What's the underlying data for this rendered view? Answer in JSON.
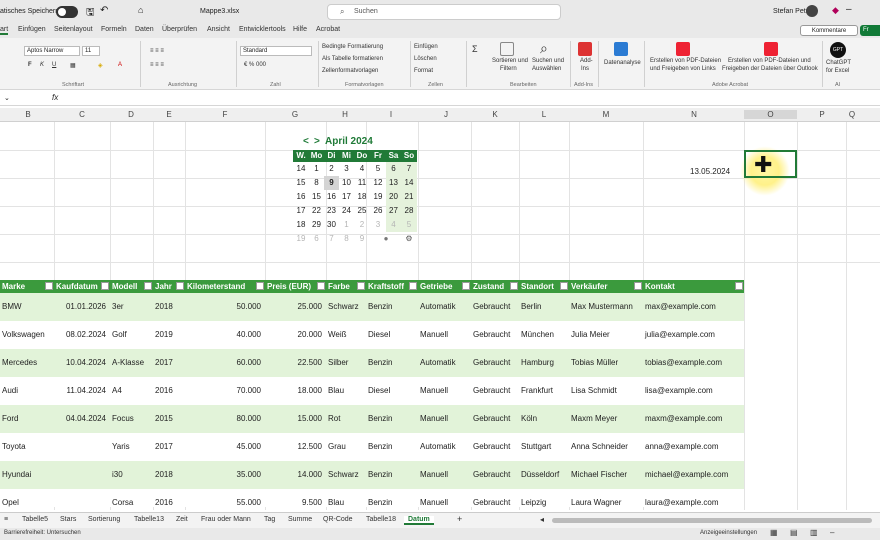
{
  "titlebar": {
    "autosave": "atisches Speichern",
    "file": "Mappe3.xlsx",
    "search": "Suchen",
    "user": "Stefan Petri"
  },
  "tabs": [
    "art",
    "Einfügen",
    "Seitenlayout",
    "Formeln",
    "Daten",
    "Überprüfen",
    "Ansicht",
    "Entwicklertools",
    "Hilfe",
    "Acrobat"
  ],
  "tabs_right": {
    "comments": "Kommentare",
    "share": "Fr"
  },
  "ribbon": {
    "font": "Aptos Narrow",
    "font_size": "11",
    "number_format": "Standard",
    "groups": [
      "Schriftart",
      "Ausrichtung",
      "Zahl",
      "Formatvorlagen",
      "Zellen",
      "Bearbeiten",
      "Add-Ins",
      "Adobe Acrobat",
      "AI"
    ],
    "items": {
      "cond": "Bedingte Formatierung",
      "astable": "Als Tabelle formatieren",
      "cellstyles": "Zellenformatvorlagen",
      "insert": "Einfügen",
      "delete": "Löschen",
      "format": "Format",
      "sort1": "Sortieren und",
      "sort2": "Filtern",
      "find1": "Suchen und",
      "find2": "Auswählen",
      "addins1": "Add-",
      "addins2": "Ins",
      "analysis": "Datenanalyse",
      "pdf1a": "Erstellen von PDF-Dateien",
      "pdf1b": "und Freigeben von Links",
      "pdf2a": "Erstellen von PDF-Dateien und",
      "pdf2b": "Freigeben der Dateien über Outlook",
      "gpt1": "ChatGPT",
      "gpt2": "for Excel",
      "gpt_icon": "GPT"
    }
  },
  "columns": [
    "B",
    "C",
    "D",
    "E",
    "F",
    "G",
    "H",
    "I",
    "J",
    "K",
    "L",
    "M",
    "N",
    "O",
    "P",
    "Q"
  ],
  "calendar": {
    "prev": "<",
    "next": ">",
    "month": "April 2024",
    "headers": [
      "W.",
      "Mo",
      "Di",
      "Mi",
      "Do",
      "Fr",
      "Sa",
      "So"
    ],
    "weeks": [
      [
        "14",
        "1",
        "2",
        "3",
        "4",
        "5",
        "6",
        "7"
      ],
      [
        "15",
        "8",
        "9",
        "10",
        "11",
        "12",
        "13",
        "14"
      ],
      [
        "16",
        "15",
        "16",
        "17",
        "18",
        "19",
        "20",
        "21"
      ],
      [
        "17",
        "22",
        "23",
        "24",
        "25",
        "26",
        "27",
        "28"
      ],
      [
        "18",
        "29",
        "30",
        "1",
        "2",
        "3",
        "4",
        "5"
      ],
      [
        "19",
        "6",
        "7",
        "8",
        "9",
        "",
        "",
        ""
      ]
    ]
  },
  "date_value": "13.05.2024",
  "table": {
    "headers": [
      "Marke",
      "Kaufdatum",
      "Modell",
      "Jahr",
      "Kilometerstand",
      "Preis (EUR)",
      "Farbe",
      "Kraftstoff",
      "Getriebe",
      "Zustand",
      "Standort",
      "Verkäufer",
      "Kontakt"
    ],
    "rows": [
      [
        "BMW",
        "01.01.2026",
        "3er",
        "2018",
        "50.000",
        "25.000",
        "Schwarz",
        "Benzin",
        "Automatik",
        "Gebraucht",
        "Berlin",
        "Max Mustermann",
        "max@example.com"
      ],
      [
        "Volkswagen",
        "08.02.2024",
        "Golf",
        "2019",
        "40.000",
        "20.000",
        "Weiß",
        "Diesel",
        "Manuell",
        "Gebraucht",
        "München",
        "Julia Meier",
        "julia@example.com"
      ],
      [
        "Mercedes",
        "10.04.2024",
        "A-Klasse",
        "2017",
        "60.000",
        "22.500",
        "Silber",
        "Benzin",
        "Automatik",
        "Gebraucht",
        "Hamburg",
        "Tobias Müller",
        "tobias@example.com"
      ],
      [
        "Audi",
        "11.04.2024",
        "A4",
        "2016",
        "70.000",
        "18.000",
        "Blau",
        "Diesel",
        "Manuell",
        "Gebraucht",
        "Frankfurt",
        "Lisa Schmidt",
        "lisa@example.com"
      ],
      [
        "Ford",
        "04.04.2024",
        "Focus",
        "2015",
        "80.000",
        "15.000",
        "Rot",
        "Benzin",
        "Manuell",
        "Gebraucht",
        "Köln",
        "Maxm Meyer",
        "maxm@example.com"
      ],
      [
        "Toyota",
        "",
        "Yaris",
        "2017",
        "45.000",
        "12.500",
        "Grau",
        "Benzin",
        "Automatik",
        "Gebraucht",
        "Stuttgart",
        "Anna Schneider",
        "anna@example.com"
      ],
      [
        "Hyundai",
        "",
        "i30",
        "2018",
        "35.000",
        "14.000",
        "Schwarz",
        "Benzin",
        "Manuell",
        "Gebraucht",
        "Düsseldorf",
        "Michael Fischer",
        "michael@example.com"
      ],
      [
        "Opel",
        "",
        "Corsa",
        "2016",
        "55.000",
        "9.500",
        "Blau",
        "Benzin",
        "Manuell",
        "Gebraucht",
        "Leipzig",
        "Laura Wagner",
        "laura@example.com"
      ]
    ]
  },
  "sheets": [
    "Tabelle5",
    "Stars",
    "Sortierung",
    "Tabelle13",
    "Zeit",
    "Frau oder Mann",
    "Tag",
    "Summe",
    "QR-Code",
    "Tabelle18",
    "Datum"
  ],
  "status": {
    "accessibility": "Barrierefreiheit: Untersuchen",
    "display": "Anzeigeeinstellungen"
  },
  "colors": {
    "accent": "#217a37",
    "table_header": "#3b9a3d",
    "row_alt": "#e2f3d9"
  }
}
